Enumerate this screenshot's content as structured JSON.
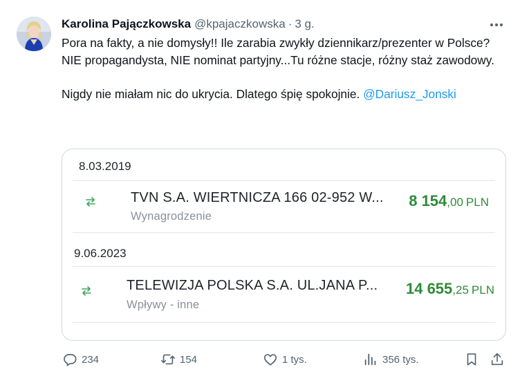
{
  "author": {
    "name": "Karolina Pajączkowska",
    "handle": "@kpajaczkowska",
    "separator": "·",
    "time": "3 g."
  },
  "tweet": {
    "line1": "Pora na fakty, a nie domysły!! Ile zarabia zwykły dziennikarz/prezenter w Polsce?",
    "line2": "NIE propagandysta, NIE nominat partyjny...Tu różne stacje, różny staż zawodowy.",
    "line3_text": "Nigdy nie miałam nic do ukrycia. Dlatego śpię spokojnie. ",
    "mention": "@Dariusz_Jonski"
  },
  "card": {
    "entries": [
      {
        "date": "8.03.2019",
        "title": "TVN S.A. WIERTNICZA 166 02-952 W...",
        "subtitle": "Wynagrodzenie",
        "amount_int": "8 154",
        "amount_dec": ",00",
        "currency": "PLN"
      },
      {
        "date": "9.06.2023",
        "title": "TELEWIZJA POLSKA S.A. UL.JANA P...",
        "subtitle": "Wpływy - inne",
        "amount_int": "14 655",
        "amount_dec": ",25",
        "currency": "PLN"
      }
    ]
  },
  "actions": {
    "replies": "234",
    "reposts": "154",
    "likes": "1 tys.",
    "views": "356 tys."
  },
  "icons": {
    "more": "more-horizontal-icon",
    "reply": "reply-icon",
    "repost": "repost-icon",
    "like": "heart-icon",
    "views": "views-chart-icon",
    "bookmark": "bookmark-icon",
    "share": "share-icon",
    "transfer": "transfer-arrows-icon"
  },
  "colors": {
    "link": "#1d9bf0",
    "amount": "#2e8b3a",
    "muted": "#536471"
  }
}
